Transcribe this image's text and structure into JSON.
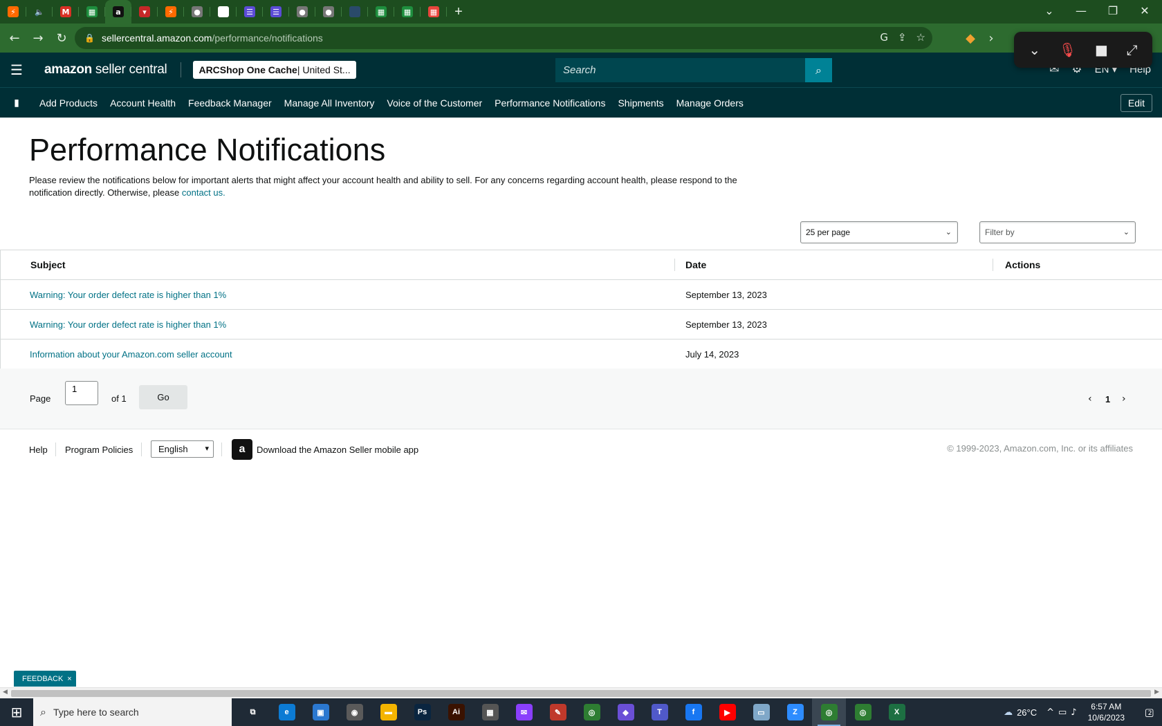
{
  "browser": {
    "tabs": [
      {
        "icon": "zapier-icon",
        "glyph": "⚡",
        "color": "#ff6a00"
      },
      {
        "icon": "audio-icon",
        "glyph": "🔈",
        "color": "transparent"
      },
      {
        "icon": "gmail-icon",
        "glyph": "M",
        "color": "#d93025"
      },
      {
        "icon": "sheets-icon",
        "glyph": "▦",
        "color": "#1e8e3e"
      },
      {
        "icon": "amazon-icon",
        "glyph": "a",
        "color": "#111111",
        "active": true
      },
      {
        "icon": "app-icon",
        "glyph": "▾",
        "color": "#c62828"
      },
      {
        "icon": "zapier-icon",
        "glyph": "⚡",
        "color": "#ff6a00"
      },
      {
        "icon": "globe-icon",
        "glyph": "●",
        "color": "#777777"
      },
      {
        "icon": "doc-icon",
        "glyph": "▤",
        "color": "#ffffff"
      },
      {
        "icon": "list-icon",
        "glyph": "☰",
        "color": "#5b4bd6"
      },
      {
        "icon": "list-icon",
        "glyph": "☰",
        "color": "#5b4bd6"
      },
      {
        "icon": "globe-icon",
        "glyph": "●",
        "color": "#777777"
      },
      {
        "icon": "globe-icon",
        "glyph": "●",
        "color": "#777777"
      },
      {
        "icon": "blank-icon",
        "glyph": "",
        "color": "#2a4a6a"
      },
      {
        "icon": "sheets-icon",
        "glyph": "▦",
        "color": "#1e8e3e"
      },
      {
        "icon": "sheets-icon",
        "glyph": "▦",
        "color": "#1e8e3e"
      },
      {
        "icon": "apps-icon",
        "glyph": "▦",
        "color": "#e8453c"
      }
    ],
    "new_tab": "+",
    "url_host": "sellercentral.amazon.com",
    "url_path": "/performance/notifications"
  },
  "header": {
    "logo_bold": "amazon",
    "logo_rest": " seller central",
    "store_name": "ARCShop One Cache",
    "store_region": " | United St...",
    "search_placeholder": "Search",
    "language": "EN ▾",
    "help": "Help"
  },
  "nav": {
    "links": [
      "Add Products",
      "Account Health",
      "Feedback Manager",
      "Manage All Inventory",
      "Voice of the Customer",
      "Performance Notifications",
      "Shipments",
      "Manage Orders"
    ],
    "edit": "Edit"
  },
  "page": {
    "title": "Performance Notifications",
    "intro": "Please review the notifications below for important alerts that might affect your account health and ability to sell. For any concerns regarding account health, please respond to the notification directly. Otherwise, please ",
    "contact_link": "contact us."
  },
  "controls": {
    "per_page": "25 per page",
    "filter": "Filter by"
  },
  "table": {
    "headers": {
      "subject": "Subject",
      "date": "Date",
      "actions": "Actions"
    },
    "rows": [
      {
        "subject": "Warning: Your order defect rate is higher than 1%",
        "date": "September 13, 2023"
      },
      {
        "subject": "Warning: Your order defect rate is higher than 1%",
        "date": "September 13, 2023"
      },
      {
        "subject": "Information about your Amazon.com seller account",
        "date": "July 14, 2023"
      }
    ]
  },
  "pagination": {
    "page_label": "Page",
    "page_value": "1",
    "of_label": "of 1",
    "go": "Go",
    "current": "1"
  },
  "footer": {
    "help": "Help",
    "policies": "Program Policies",
    "language": "English",
    "download": "Download the Amazon Seller mobile app",
    "copyright": "© 1999-2023, Amazon.com, Inc. or its affiliates"
  },
  "feedback": {
    "label": "FEEDBACK",
    "close": "×"
  },
  "taskbar": {
    "search_placeholder": "Type here to search",
    "apps": [
      {
        "icon": "task-view-icon",
        "glyph": "⧉",
        "color": "transparent"
      },
      {
        "icon": "edge-icon",
        "glyph": "e",
        "color": "#0c7bd4"
      },
      {
        "icon": "store-icon",
        "glyph": "▣",
        "color": "#2b78d0"
      },
      {
        "icon": "camera-icon",
        "glyph": "◉",
        "color": "#5a5a5a"
      },
      {
        "icon": "folder-icon",
        "glyph": "▬",
        "color": "#f4b400"
      },
      {
        "icon": "photoshop-icon",
        "glyph": "Ps",
        "color": "#0a2540"
      },
      {
        "icon": "illustrator-icon",
        "glyph": "Ai",
        "color": "#3a1200"
      },
      {
        "icon": "calculator-icon",
        "glyph": "▦",
        "color": "#555555"
      },
      {
        "icon": "messenger-icon",
        "glyph": "✉",
        "color": "#8a3ffc"
      },
      {
        "icon": "pen-icon",
        "glyph": "✎",
        "color": "#c0392b"
      },
      {
        "icon": "chrome-icon",
        "glyph": "◎",
        "color": "#2e7d32"
      },
      {
        "icon": "app-icon",
        "glyph": "◆",
        "color": "#6a4fd6"
      },
      {
        "icon": "teams-icon",
        "glyph": "T",
        "color": "#5059c9"
      },
      {
        "icon": "facebook-icon",
        "glyph": "f",
        "color": "#1877f2"
      },
      {
        "icon": "youtube-icon",
        "glyph": "▶",
        "color": "#ff0000"
      },
      {
        "icon": "notes-icon",
        "glyph": "▭",
        "color": "#7fa7c8"
      },
      {
        "icon": "zoom-icon",
        "glyph": "Z",
        "color": "#2d8cff"
      },
      {
        "icon": "chrome-icon",
        "glyph": "◎",
        "color": "#2e7d32",
        "active": true
      },
      {
        "icon": "chrome-icon",
        "glyph": "◎",
        "color": "#2e7d32"
      },
      {
        "icon": "excel-icon",
        "glyph": "X",
        "color": "#1d6f42"
      }
    ],
    "temperature": "26°C",
    "time": "6:57 AM",
    "date": "10/6/2023",
    "notifications": "2"
  }
}
